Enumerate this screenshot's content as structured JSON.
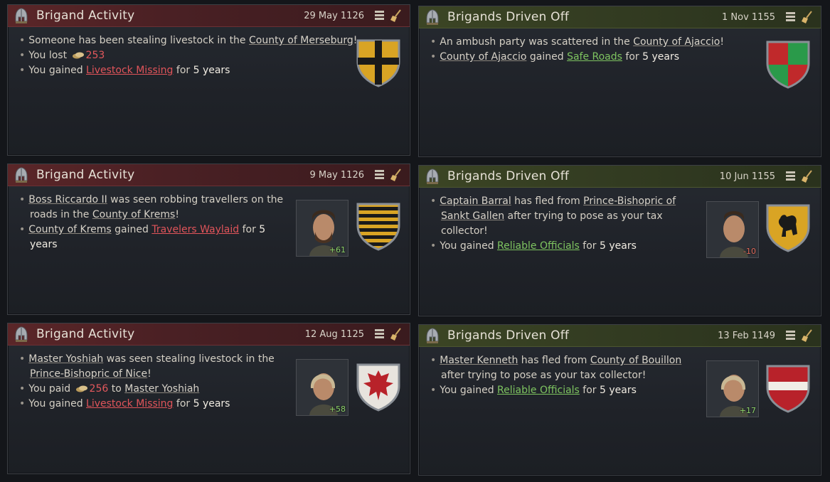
{
  "cards": [
    {
      "title": "Brigand Activity",
      "date": "29 May 1126",
      "theme": "red",
      "lines": {
        "l1_pre": "Someone has been stealing livestock in the ",
        "l1_link": "County of Merseburg",
        "l1_post": "!",
        "l2_pre": "You lost ",
        "l2_value": "253",
        "l3_pre": "You gained ",
        "l3_link": "Livestock Missing",
        "l3_mid": " for ",
        "l3_bold": "5 years"
      }
    },
    {
      "title": "Brigands Driven Off",
      "date": "1 Nov 1155",
      "theme": "green",
      "lines": {
        "l1_pre": "An ambush party was scattered in the ",
        "l1_link": "County of Ajaccio",
        "l1_post": "!",
        "l2_link": "County of Ajaccio",
        "l2_mid": " gained ",
        "l2_link2": "Safe Roads",
        "l2_mid2": " for ",
        "l2_bold": "5 years"
      }
    },
    {
      "title": "Brigand Activity",
      "date": "9 May 1126",
      "theme": "red",
      "portrait_opinion": "+61",
      "lines": {
        "l1_link": "Boss Riccardo II",
        "l1_post": " was seen robbing travellers on the",
        "l1b_pre": "roads in the ",
        "l1b_link": "County of Krems",
        "l1b_post": "!",
        "l2_link": "County of Krems",
        "l2_mid": " gained ",
        "l2_link2": "Travelers Waylaid",
        "l2_mid2": " for ",
        "l2_bold": "5",
        "l2b_bold": "years"
      }
    },
    {
      "title": "Brigands Driven Off",
      "date": "10 Jun 1155",
      "theme": "green",
      "portrait_opinion": "-10",
      "lines": {
        "l1_link": "Captain Barral",
        "l1_mid": " has fled from ",
        "l1_link2": "Prince-Bishopric of",
        "l1b_link": "Sankt Gallen",
        "l1b_post": " after trying to pose as your tax",
        "l1c": "collector!",
        "l2_pre": "You gained ",
        "l2_link": "Reliable Officials",
        "l2_mid": " for ",
        "l2_bold": "5 years"
      }
    },
    {
      "title": "Brigand Activity",
      "date": "12 Aug 1125",
      "theme": "red",
      "portrait_opinion": "+58",
      "lines": {
        "l1_link": "Master Yoshiah",
        "l1_post": " was seen stealing livestock in the",
        "l1b_link": "Prince-Bishopric of Nice",
        "l1b_post": "!",
        "l2_pre": "You paid ",
        "l2_value": "256",
        "l2_mid": " to ",
        "l2_link": "Master Yoshiah",
        "l3_pre": "You gained ",
        "l3_link": "Livestock Missing",
        "l3_mid": " for ",
        "l3_bold": "5 years"
      }
    },
    {
      "title": "Brigands Driven Off",
      "date": "13 Feb 1149",
      "theme": "green",
      "portrait_opinion": "+17",
      "lines": {
        "l1_link": "Master Kenneth",
        "l1_mid": " has fled from ",
        "l1_link2": "County of Bouillon",
        "l1b": "after trying to pose as your tax collector!",
        "l2_pre": "You gained ",
        "l2_link": "Reliable Officials",
        "l2_mid": " for ",
        "l2_bold": "5 years"
      }
    }
  ],
  "icons": {
    "header": "helmet-icon",
    "menu": "menu-icon",
    "dismiss": "broom-icon",
    "gold": "gold-coins-icon"
  },
  "colors": {
    "negative_modifier": "#e0545a",
    "positive_modifier": "#7ec460",
    "red_header": "#5a2628",
    "green_header": "#3c4524"
  }
}
